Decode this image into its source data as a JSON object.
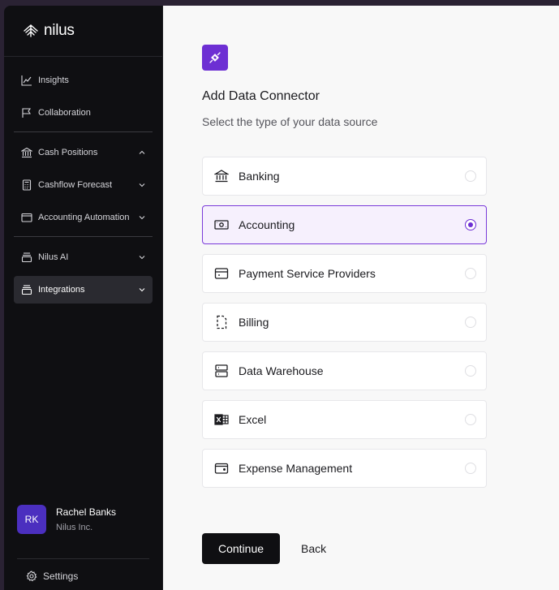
{
  "brand": {
    "name": "nilus"
  },
  "sidebar": {
    "items": [
      {
        "label": "Insights",
        "icon": "chart-line-icon"
      },
      {
        "label": "Collaboration",
        "icon": "flag-icon"
      },
      {
        "label": "Cash Positions",
        "icon": "bank-icon",
        "expanded": true
      },
      {
        "label": "Cashflow Forecast",
        "icon": "calculator-icon"
      },
      {
        "label": "Accounting Automation",
        "icon": "folder-icon"
      },
      {
        "label": "Nilus AI",
        "icon": "stack-icon"
      },
      {
        "label": "Integrations",
        "icon": "stack-icon",
        "active": true
      }
    ]
  },
  "user": {
    "initials": "RK",
    "name": "Rachel Banks",
    "org": "Nilus Inc."
  },
  "settings": {
    "label": "Settings"
  },
  "main": {
    "title": "Add Data Connector",
    "subtitle": "Select the type of your data source",
    "selected": "Accounting",
    "options": [
      {
        "label": "Banking",
        "icon": "bank-icon"
      },
      {
        "label": "Accounting",
        "icon": "banknote-icon"
      },
      {
        "label": "Payment Service Providers",
        "icon": "wallet-card-icon"
      },
      {
        "label": "Billing",
        "icon": "dashed-document-icon"
      },
      {
        "label": "Data Warehouse",
        "icon": "server-icon"
      },
      {
        "label": "Excel",
        "icon": "excel-icon"
      },
      {
        "label": "Expense Management",
        "icon": "wallet-icon"
      }
    ],
    "continue_label": "Continue",
    "back_label": "Back"
  },
  "colors": {
    "accent": "#6d2fd3",
    "sidebar_bg": "#0f0f12",
    "selected_bg": "#f6f0fd"
  }
}
